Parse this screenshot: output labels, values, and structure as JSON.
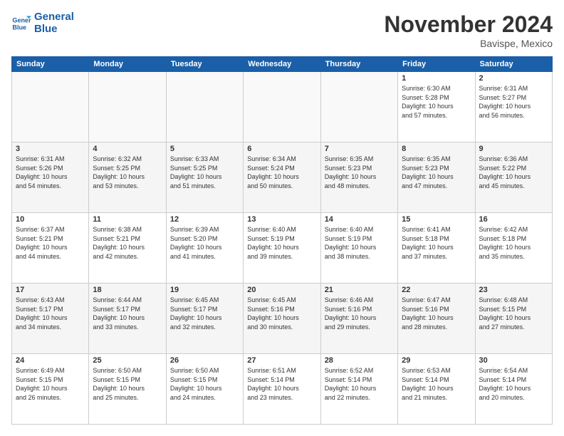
{
  "header": {
    "logo_line1": "General",
    "logo_line2": "Blue",
    "month": "November 2024",
    "location": "Bavispe, Mexico"
  },
  "weekdays": [
    "Sunday",
    "Monday",
    "Tuesday",
    "Wednesday",
    "Thursday",
    "Friday",
    "Saturday"
  ],
  "weeks": [
    [
      {
        "day": "",
        "info": ""
      },
      {
        "day": "",
        "info": ""
      },
      {
        "day": "",
        "info": ""
      },
      {
        "day": "",
        "info": ""
      },
      {
        "day": "",
        "info": ""
      },
      {
        "day": "1",
        "info": "Sunrise: 6:30 AM\nSunset: 5:28 PM\nDaylight: 10 hours\nand 57 minutes."
      },
      {
        "day": "2",
        "info": "Sunrise: 6:31 AM\nSunset: 5:27 PM\nDaylight: 10 hours\nand 56 minutes."
      }
    ],
    [
      {
        "day": "3",
        "info": "Sunrise: 6:31 AM\nSunset: 5:26 PM\nDaylight: 10 hours\nand 54 minutes."
      },
      {
        "day": "4",
        "info": "Sunrise: 6:32 AM\nSunset: 5:25 PM\nDaylight: 10 hours\nand 53 minutes."
      },
      {
        "day": "5",
        "info": "Sunrise: 6:33 AM\nSunset: 5:25 PM\nDaylight: 10 hours\nand 51 minutes."
      },
      {
        "day": "6",
        "info": "Sunrise: 6:34 AM\nSunset: 5:24 PM\nDaylight: 10 hours\nand 50 minutes."
      },
      {
        "day": "7",
        "info": "Sunrise: 6:35 AM\nSunset: 5:23 PM\nDaylight: 10 hours\nand 48 minutes."
      },
      {
        "day": "8",
        "info": "Sunrise: 6:35 AM\nSunset: 5:23 PM\nDaylight: 10 hours\nand 47 minutes."
      },
      {
        "day": "9",
        "info": "Sunrise: 6:36 AM\nSunset: 5:22 PM\nDaylight: 10 hours\nand 45 minutes."
      }
    ],
    [
      {
        "day": "10",
        "info": "Sunrise: 6:37 AM\nSunset: 5:21 PM\nDaylight: 10 hours\nand 44 minutes."
      },
      {
        "day": "11",
        "info": "Sunrise: 6:38 AM\nSunset: 5:21 PM\nDaylight: 10 hours\nand 42 minutes."
      },
      {
        "day": "12",
        "info": "Sunrise: 6:39 AM\nSunset: 5:20 PM\nDaylight: 10 hours\nand 41 minutes."
      },
      {
        "day": "13",
        "info": "Sunrise: 6:40 AM\nSunset: 5:19 PM\nDaylight: 10 hours\nand 39 minutes."
      },
      {
        "day": "14",
        "info": "Sunrise: 6:40 AM\nSunset: 5:19 PM\nDaylight: 10 hours\nand 38 minutes."
      },
      {
        "day": "15",
        "info": "Sunrise: 6:41 AM\nSunset: 5:18 PM\nDaylight: 10 hours\nand 37 minutes."
      },
      {
        "day": "16",
        "info": "Sunrise: 6:42 AM\nSunset: 5:18 PM\nDaylight: 10 hours\nand 35 minutes."
      }
    ],
    [
      {
        "day": "17",
        "info": "Sunrise: 6:43 AM\nSunset: 5:17 PM\nDaylight: 10 hours\nand 34 minutes."
      },
      {
        "day": "18",
        "info": "Sunrise: 6:44 AM\nSunset: 5:17 PM\nDaylight: 10 hours\nand 33 minutes."
      },
      {
        "day": "19",
        "info": "Sunrise: 6:45 AM\nSunset: 5:17 PM\nDaylight: 10 hours\nand 32 minutes."
      },
      {
        "day": "20",
        "info": "Sunrise: 6:45 AM\nSunset: 5:16 PM\nDaylight: 10 hours\nand 30 minutes."
      },
      {
        "day": "21",
        "info": "Sunrise: 6:46 AM\nSunset: 5:16 PM\nDaylight: 10 hours\nand 29 minutes."
      },
      {
        "day": "22",
        "info": "Sunrise: 6:47 AM\nSunset: 5:16 PM\nDaylight: 10 hours\nand 28 minutes."
      },
      {
        "day": "23",
        "info": "Sunrise: 6:48 AM\nSunset: 5:15 PM\nDaylight: 10 hours\nand 27 minutes."
      }
    ],
    [
      {
        "day": "24",
        "info": "Sunrise: 6:49 AM\nSunset: 5:15 PM\nDaylight: 10 hours\nand 26 minutes."
      },
      {
        "day": "25",
        "info": "Sunrise: 6:50 AM\nSunset: 5:15 PM\nDaylight: 10 hours\nand 25 minutes."
      },
      {
        "day": "26",
        "info": "Sunrise: 6:50 AM\nSunset: 5:15 PM\nDaylight: 10 hours\nand 24 minutes."
      },
      {
        "day": "27",
        "info": "Sunrise: 6:51 AM\nSunset: 5:14 PM\nDaylight: 10 hours\nand 23 minutes."
      },
      {
        "day": "28",
        "info": "Sunrise: 6:52 AM\nSunset: 5:14 PM\nDaylight: 10 hours\nand 22 minutes."
      },
      {
        "day": "29",
        "info": "Sunrise: 6:53 AM\nSunset: 5:14 PM\nDaylight: 10 hours\nand 21 minutes."
      },
      {
        "day": "30",
        "info": "Sunrise: 6:54 AM\nSunset: 5:14 PM\nDaylight: 10 hours\nand 20 minutes."
      }
    ]
  ]
}
